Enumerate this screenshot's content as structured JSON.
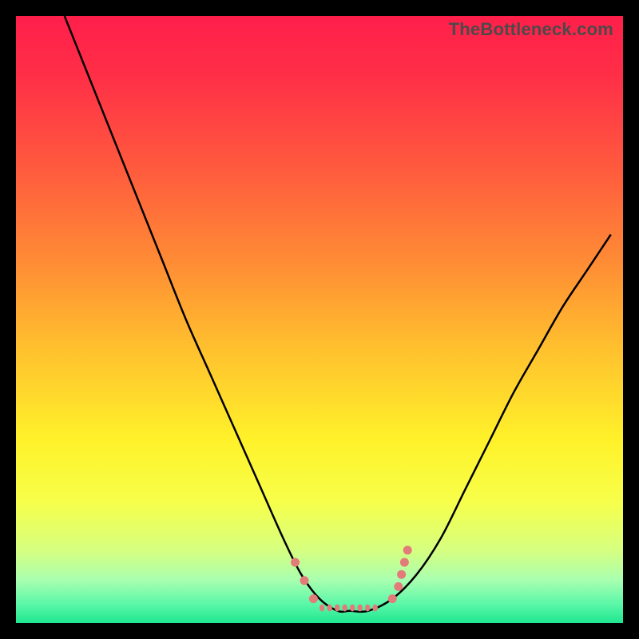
{
  "watermark": "TheBottleneck.com",
  "colors": {
    "frame": "#000000",
    "curve": "#000000",
    "marker": "#e27b79",
    "gradient_stops": [
      {
        "offset": 0.0,
        "color": "#ff1f4a"
      },
      {
        "offset": 0.1,
        "color": "#ff2f47"
      },
      {
        "offset": 0.25,
        "color": "#ff5a3e"
      },
      {
        "offset": 0.4,
        "color": "#ff8a35"
      },
      {
        "offset": 0.55,
        "color": "#ffc12e"
      },
      {
        "offset": 0.7,
        "color": "#fff22a"
      },
      {
        "offset": 0.8,
        "color": "#f7ff4a"
      },
      {
        "offset": 0.88,
        "color": "#d6ff80"
      },
      {
        "offset": 0.93,
        "color": "#a8ffb0"
      },
      {
        "offset": 0.97,
        "color": "#58f7a8"
      },
      {
        "offset": 1.0,
        "color": "#1fe68f"
      }
    ]
  },
  "chart_data": {
    "type": "line",
    "title": "",
    "xlabel": "",
    "ylabel": "",
    "xlim": [
      0,
      100
    ],
    "ylim": [
      0,
      100
    ],
    "grid": false,
    "legend": null,
    "comment": "Axes unlabeled; values are percent of plot area. y=0 at bottom (curve trough), y=100 at top.",
    "series": [
      {
        "name": "bottleneck-curve",
        "x": [
          8,
          12,
          16,
          20,
          24,
          28,
          32,
          36,
          40,
          44,
          47,
          50,
          53,
          55,
          58,
          62,
          66,
          70,
          74,
          78,
          82,
          86,
          90,
          94,
          98
        ],
        "y": [
          100,
          90,
          80,
          70,
          60,
          50,
          41,
          32,
          23,
          14,
          8,
          4,
          2,
          2,
          2,
          4,
          8,
          14,
          22,
          30,
          38,
          45,
          52,
          58,
          64
        ]
      }
    ],
    "flat_region": {
      "x_start": 50,
      "x_end": 60,
      "y": 2
    },
    "markers": {
      "comment": "Salmon dotted/dashed markers near the trough",
      "points": [
        {
          "x": 46,
          "y": 10
        },
        {
          "x": 47.5,
          "y": 7
        },
        {
          "x": 49,
          "y": 4
        },
        {
          "x": 62,
          "y": 4
        },
        {
          "x": 63,
          "y": 6
        },
        {
          "x": 63.5,
          "y": 8
        },
        {
          "x": 64,
          "y": 10
        },
        {
          "x": 64.5,
          "y": 12
        }
      ],
      "flat_dash": {
        "x_start": 50,
        "x_end": 60,
        "y": 2.5,
        "segments": 8
      }
    }
  }
}
